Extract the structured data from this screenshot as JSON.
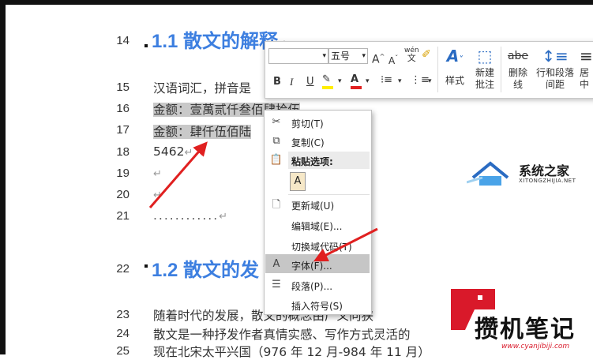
{
  "document": {
    "line_numbers": [
      "14",
      "15",
      "16",
      "17",
      "18",
      "19",
      "20",
      "21",
      "22",
      "23",
      "24",
      "25"
    ],
    "heading1": "1.1 散文的解释",
    "line15": "汉语词汇，拼音是",
    "line16_label": "金额：",
    "line16_value": "壹萬贰仟叁佰肆拾伍",
    "line17_label": "金额：",
    "line17_value": "肆仟伍佰陆",
    "line18": "金额：",
    "line18_value": "5462",
    "dots": "............",
    "heading2": "1.2 散文的发",
    "line23": "随着时代的发展，散文的概念由广义向狭",
    "line24": "散文是一种抒发作者真情实感、写作方式灵活的",
    "line25": "现在北宋太平兴国（976 年 12 月-984 年 11 月）",
    "para_mark": "↵"
  },
  "mini_toolbar": {
    "font_name": "",
    "font_size": "五号",
    "grow_font": "A",
    "shrink_font": "A",
    "phonetic": "wén",
    "bold": "B",
    "italic": "I",
    "underline": "U",
    "styles_label": "样式",
    "new_comment_label": "新建批注",
    "new_comment_1": "新建",
    "new_comment_2": "批注",
    "strikethrough_icon_text": "abe",
    "strikethrough_1": "删除",
    "strikethrough_2": "线",
    "line_spacing_1": "行和段落",
    "line_spacing_2": "间距",
    "center_partial": "居中"
  },
  "context_menu": {
    "cut": "剪切(T)",
    "copy": "复制(C)",
    "paste_options": "粘贴选项:",
    "paste_glyph": "A",
    "update_field": "更新域(U)",
    "edit_field": "编辑域(E)...",
    "toggle_field_codes": "切换域代码(T)",
    "font": "字体(F)...",
    "paragraph": "段落(P)...",
    "insert_symbol": "插入符号(S)",
    "font_icon_text": "A"
  },
  "watermarks": {
    "top_title": "系统之家",
    "top_url": "XITONGZHIJIA.NET",
    "bottom_title": "攒机笔记",
    "bottom_url": "www.cyanjibiji.com"
  },
  "colors": {
    "heading": "#3d7fe0",
    "arrow": "#e02020",
    "selection": "#c9c9c9",
    "menu_hover": "#c6c6c6",
    "watermark_red": "#d9192a"
  }
}
